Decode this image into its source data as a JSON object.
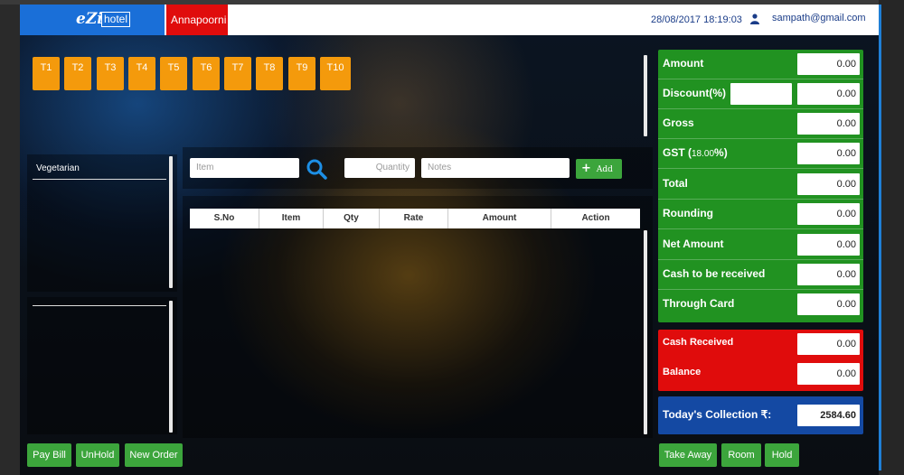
{
  "header": {
    "logo_script": "eZi",
    "logo_hotel": "hotel",
    "branch": "Annapoorni",
    "datetime": "28/08/2017 18:19:03",
    "user_email": "sampath@gmail.com"
  },
  "tables": [
    "T1",
    "T2",
    "T3",
    "T4",
    "T5",
    "T6",
    "T7",
    "T8",
    "T9",
    "T10"
  ],
  "categories": {
    "first": "Vegetarian"
  },
  "entry": {
    "item_placeholder": "Item",
    "quantity_placeholder": "Quantity",
    "notes_placeholder": "Notes",
    "add_label": "Add"
  },
  "grid": {
    "columns": [
      "S.No",
      "Item",
      "Qty",
      "Rate",
      "Amount",
      "Action"
    ]
  },
  "actions": {
    "pay_bill": "Pay Bill",
    "unhold": "UnHold",
    "new_order": "New Order",
    "take_away": "Take Away",
    "room": "Room",
    "hold": "Hold"
  },
  "summary": {
    "amount": {
      "label": "Amount",
      "value": "0.00"
    },
    "discount": {
      "label": "Discount(%)",
      "value": "0.00"
    },
    "gross": {
      "label": "Gross",
      "value": "0.00"
    },
    "gst": {
      "label": "GST (",
      "rate": "18.00",
      "label_end": "%)",
      "value": "0.00"
    },
    "total": {
      "label": "Total",
      "value": "0.00"
    },
    "rounding": {
      "label": "Rounding",
      "value": "0.00"
    },
    "net_amount": {
      "label": "Net Amount",
      "value": "0.00"
    },
    "cash_to_receive": {
      "label": "Cash to be received",
      "value": "0.00"
    },
    "through_card": {
      "label": "Through Card",
      "value": "0.00"
    },
    "cash_received": {
      "label": "Cash Received",
      "value": "0.00"
    },
    "balance": {
      "label": "Balance",
      "value": "0.00"
    },
    "todays_collection": {
      "label": "Today's Collection ₹:",
      "value": "2584.60"
    }
  },
  "colors": {
    "brand_blue": "#1a6fd8",
    "branch_red": "#e00c0c",
    "table_orange": "#f49a0c",
    "action_green": "#3ca53c",
    "summary_green": "#219221",
    "collection_blue": "#1449a3"
  }
}
